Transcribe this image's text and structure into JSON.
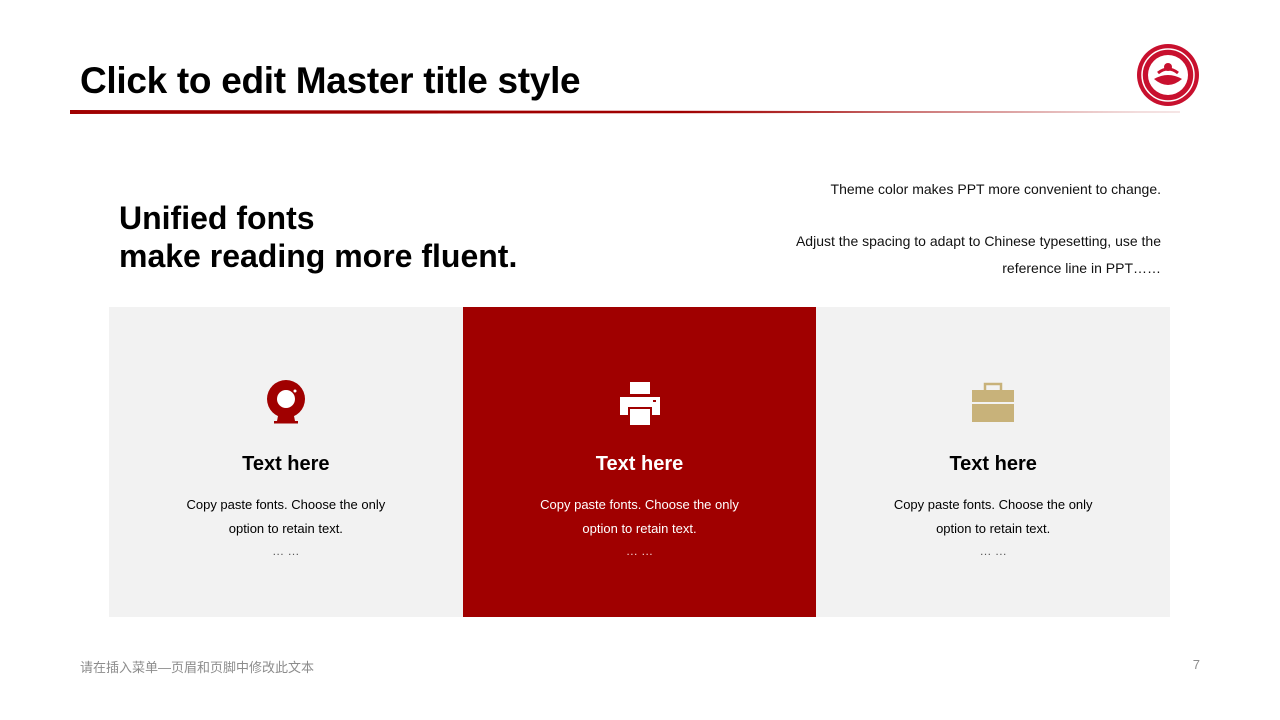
{
  "slide": {
    "title": "Click to edit Master title style",
    "headline_line1": "Unified fonts",
    "headline_line2": "make reading more fluent.",
    "description_1": "Theme color makes PPT more convenient  to change.",
    "description_2": "Adjust  the  spacing  to adapt  to Chinese  typesetting,  use  the reference  line  in  PPT……",
    "colors": {
      "accent": "#a00000",
      "card_bg": "#f2f2f2",
      "gold": "#c8b27a"
    }
  },
  "cards": [
    {
      "icon": "webcam-icon",
      "title": "Text here",
      "text": "Copy paste fonts. Choose the only option to retain text.",
      "more": "… …"
    },
    {
      "icon": "printer-icon",
      "title": "Text here",
      "text": "Copy paste fonts. Choose the only option to retain text.",
      "more": "… …"
    },
    {
      "icon": "toolbox-icon",
      "title": "Text here",
      "text": "Copy paste fonts. Choose the only option to retain text.",
      "more": "… …"
    }
  ],
  "footer": {
    "text": "请在插入菜单—页眉和页脚中修改此文本",
    "page_number": "7"
  }
}
